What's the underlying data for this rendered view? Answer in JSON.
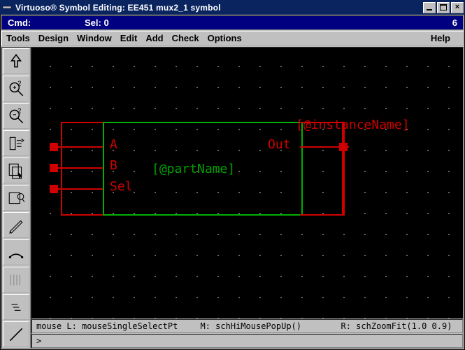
{
  "window": {
    "title": "Virtuoso® Symbol Editing: EE451 mux2_1 symbol"
  },
  "cmdbar": {
    "cmd_label": "Cmd:",
    "sel_label": "Sel: 0",
    "right_num": "6"
  },
  "menus": {
    "tools": "Tools",
    "design": "Design",
    "window": "Window",
    "edit": "Edit",
    "add": "Add",
    "check": "Check",
    "options": "Options",
    "help": "Help"
  },
  "symbol": {
    "pins": {
      "a": "A",
      "b": "B",
      "sel": "Sel",
      "out": "Out"
    },
    "partName": "[@partName]",
    "instanceName": "[@instanceName]"
  },
  "status": {
    "left": "mouse L: mouseSingleSelectPt",
    "mid": "M: schHiMousePopUp()",
    "right": "R: schZoomFit(1.0 0.9)"
  },
  "prompt": ">"
}
